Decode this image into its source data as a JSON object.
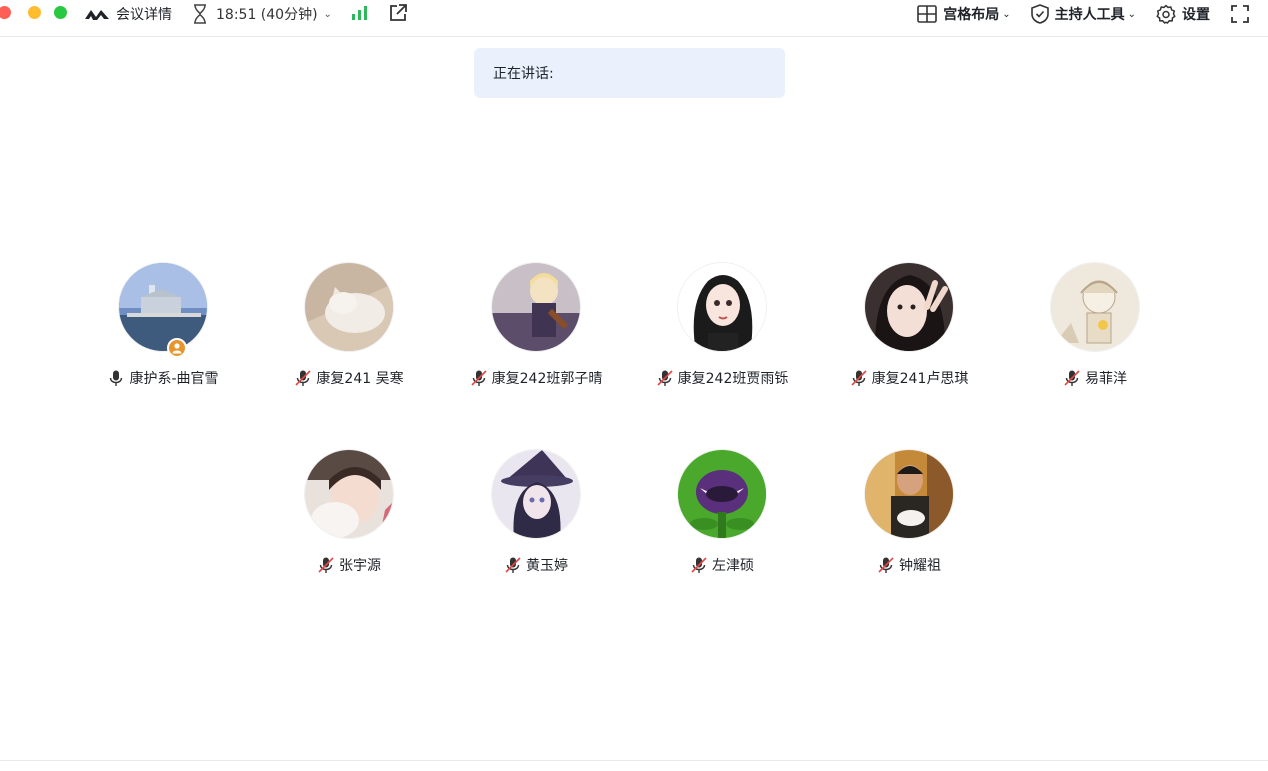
{
  "topbar": {
    "meeting_details": "会议详情",
    "timer": "18:51 (40分钟)",
    "layout_label": "宫格布局",
    "host_tools_label": "主持人工具",
    "settings_label": "设置"
  },
  "speaking_banner": "正在讲话:",
  "participants": [
    {
      "name": "康护系-曲官雪",
      "mic": "on",
      "host": true,
      "avatar": "harbor-photo"
    },
    {
      "name": "康复241 吴寒",
      "mic": "muted",
      "host": false,
      "avatar": "sleeping-cat"
    },
    {
      "name": "康复242班郭子晴",
      "mic": "muted",
      "host": false,
      "avatar": "anime-violinist"
    },
    {
      "name": "康复242班贾雨铄",
      "mic": "muted",
      "host": false,
      "avatar": "cartoon-girl"
    },
    {
      "name": "康复241卢思琪",
      "mic": "muted",
      "host": false,
      "avatar": "selfie-peace-sign"
    },
    {
      "name": "易菲洋",
      "mic": "muted",
      "host": false,
      "avatar": "sketch-character"
    },
    {
      "name": "张宇源",
      "mic": "muted",
      "host": false,
      "avatar": "child-photo"
    },
    {
      "name": "黄玉婷",
      "mic": "muted",
      "host": false,
      "avatar": "anime-witch"
    },
    {
      "name": "左津硕",
      "mic": "muted",
      "host": false,
      "avatar": "piranha-plant"
    },
    {
      "name": "钟耀祖",
      "mic": "muted",
      "host": false,
      "avatar": "man-eating"
    }
  ],
  "colors": {
    "speaking_bg": "#ebf1fc",
    "host_badge": "#e8962b",
    "signal_green": "#2fb85a"
  }
}
